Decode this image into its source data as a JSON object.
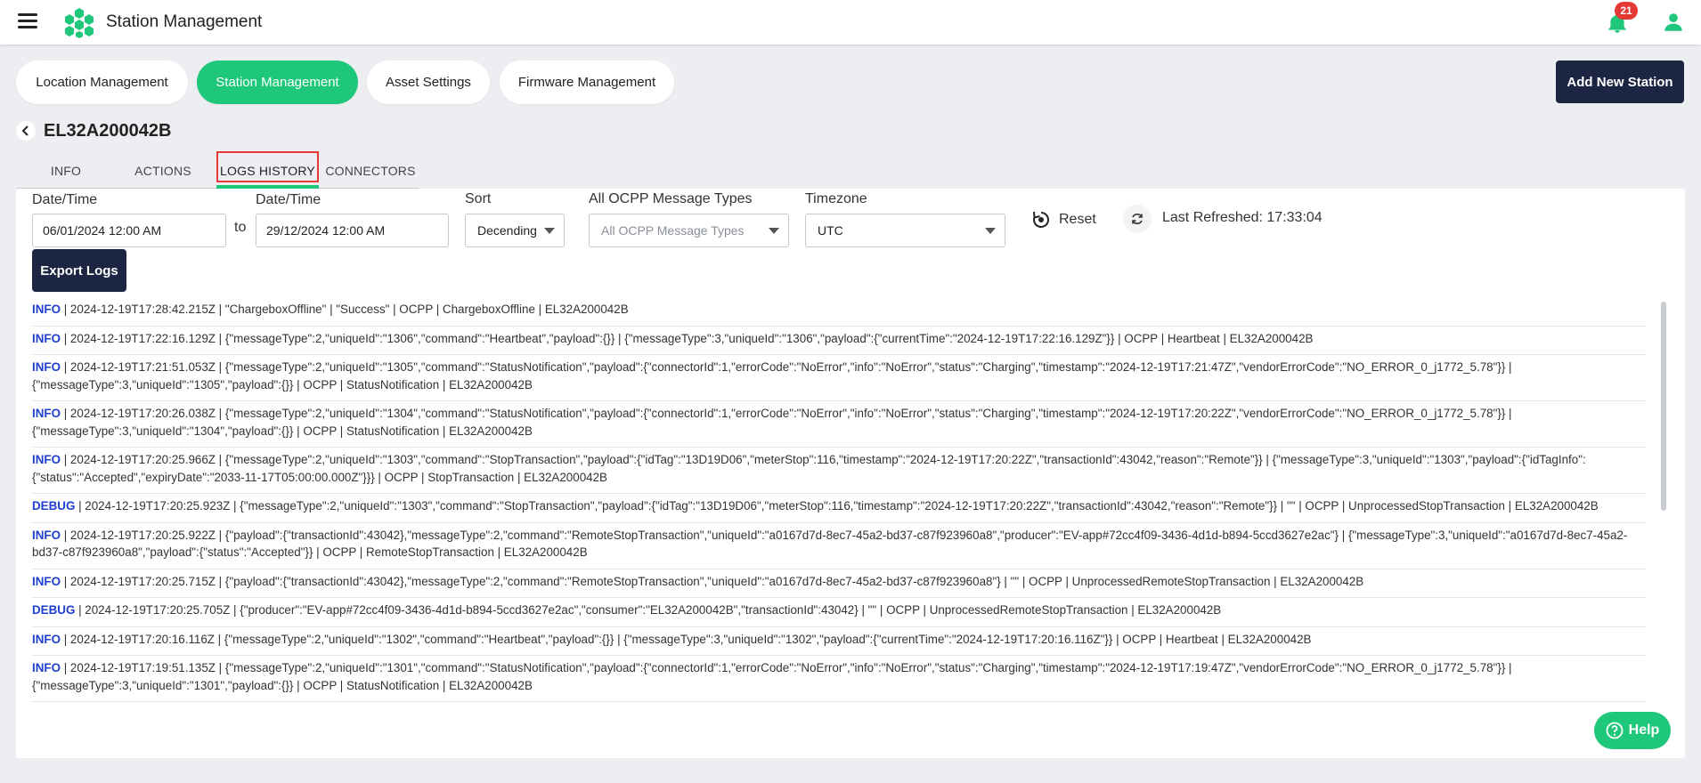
{
  "header": {
    "title": "Station Management",
    "notification_count": "21"
  },
  "main_tabs": [
    {
      "label": "Location Management",
      "active": false
    },
    {
      "label": "Station Management",
      "active": true
    },
    {
      "label": "Asset Settings",
      "active": false
    },
    {
      "label": "Firmware Management",
      "active": false
    }
  ],
  "add_station_label": "Add New Station",
  "station": {
    "id": "EL32A200042B"
  },
  "sub_tabs": [
    {
      "label": "INFO"
    },
    {
      "label": "ACTIONS"
    },
    {
      "label": "LOGS HISTORY",
      "active": true
    },
    {
      "label": "CONNECTORS"
    }
  ],
  "filters": {
    "from_label": "Date/Time",
    "from_value": "06/01/2024 12:00 AM",
    "to_text": "to",
    "to_label": "Date/Time",
    "to_value": "29/12/2024 12:00 AM",
    "sort_label": "Sort",
    "sort_value": "Decending",
    "types_label": "All OCPP Message Types",
    "types_placeholder": "All OCPP Message Types",
    "timezone_label": "Timezone",
    "timezone_value": "UTC",
    "reset_label": "Reset",
    "last_refreshed": "Last Refreshed: 17:33:04"
  },
  "export_label": "Export Logs",
  "logs": [
    {
      "level": "INFO",
      "text": " | 2024-12-19T17:28:42.215Z | \"ChargeboxOffline\" | \"Success\" | OCPP | ChargeboxOffline | EL32A200042B"
    },
    {
      "level": "INFO",
      "text": " | 2024-12-19T17:22:16.129Z | {\"messageType\":2,\"uniqueId\":\"1306\",\"command\":\"Heartbeat\",\"payload\":{}} | {\"messageType\":3,\"uniqueId\":\"1306\",\"payload\":{\"currentTime\":\"2024-12-19T17:22:16.129Z\"}} | OCPP | Heartbeat | EL32A200042B"
    },
    {
      "level": "INFO",
      "text": " | 2024-12-19T17:21:51.053Z | {\"messageType\":2,\"uniqueId\":\"1305\",\"command\":\"StatusNotification\",\"payload\":{\"connectorId\":1,\"errorCode\":\"NoError\",\"info\":\"NoError\",\"status\":\"Charging\",\"timestamp\":\"2024-12-19T17:21:47Z\",\"vendorErrorCode\":\"NO_ERROR_0_j1772_5.78\"}} | {\"messageType\":3,\"uniqueId\":\"1305\",\"payload\":{}} | OCPP | StatusNotification | EL32A200042B"
    },
    {
      "level": "INFO",
      "text": " | 2024-12-19T17:20:26.038Z | {\"messageType\":2,\"uniqueId\":\"1304\",\"command\":\"StatusNotification\",\"payload\":{\"connectorId\":1,\"errorCode\":\"NoError\",\"info\":\"NoError\",\"status\":\"Charging\",\"timestamp\":\"2024-12-19T17:20:22Z\",\"vendorErrorCode\":\"NO_ERROR_0_j1772_5.78\"}} | {\"messageType\":3,\"uniqueId\":\"1304\",\"payload\":{}} | OCPP | StatusNotification | EL32A200042B"
    },
    {
      "level": "INFO",
      "text": " | 2024-12-19T17:20:25.966Z | {\"messageType\":2,\"uniqueId\":\"1303\",\"command\":\"StopTransaction\",\"payload\":{\"idTag\":\"13D19D06\",\"meterStop\":116,\"timestamp\":\"2024-12-19T17:20:22Z\",\"transactionId\":43042,\"reason\":\"Remote\"}} | {\"messageType\":3,\"uniqueId\":\"1303\",\"payload\":{\"idTagInfo\":{\"status\":\"Accepted\",\"expiryDate\":\"2033-11-17T05:00:00.000Z\"}}} | OCPP | StopTransaction | EL32A200042B"
    },
    {
      "level": "DEBUG",
      "text": " | 2024-12-19T17:20:25.923Z | {\"messageType\":2,\"uniqueId\":\"1303\",\"command\":\"StopTransaction\",\"payload\":{\"idTag\":\"13D19D06\",\"meterStop\":116,\"timestamp\":\"2024-12-19T17:20:22Z\",\"transactionId\":43042,\"reason\":\"Remote\"}} | \"\" | OCPP | UnprocessedStopTransaction | EL32A200042B"
    },
    {
      "level": "INFO",
      "text": " | 2024-12-19T17:20:25.922Z | {\"payload\":{\"transactionId\":43042},\"messageType\":2,\"command\":\"RemoteStopTransaction\",\"uniqueId\":\"a0167d7d-8ec7-45a2-bd37-c87f923960a8\",\"producer\":\"EV-app#72cc4f09-3436-4d1d-b894-5ccd3627e2ac\"} | {\"messageType\":3,\"uniqueId\":\"a0167d7d-8ec7-45a2-bd37-c87f923960a8\",\"payload\":{\"status\":\"Accepted\"}} | OCPP | RemoteStopTransaction | EL32A200042B"
    },
    {
      "level": "INFO",
      "text": " | 2024-12-19T17:20:25.715Z | {\"payload\":{\"transactionId\":43042},\"messageType\":2,\"command\":\"RemoteStopTransaction\",\"uniqueId\":\"a0167d7d-8ec7-45a2-bd37-c87f923960a8\"} | \"\" | OCPP | UnprocessedRemoteStopTransaction | EL32A200042B"
    },
    {
      "level": "DEBUG",
      "text": " | 2024-12-19T17:20:25.705Z | {\"producer\":\"EV-app#72cc4f09-3436-4d1d-b894-5ccd3627e2ac\",\"consumer\":\"EL32A200042B\",\"transactionId\":43042} | \"\" | OCPP | UnprocessedRemoteStopTransaction | EL32A200042B"
    },
    {
      "level": "INFO",
      "text": " | 2024-12-19T17:20:16.116Z | {\"messageType\":2,\"uniqueId\":\"1302\",\"command\":\"Heartbeat\",\"payload\":{}} | {\"messageType\":3,\"uniqueId\":\"1302\",\"payload\":{\"currentTime\":\"2024-12-19T17:20:16.116Z\"}} | OCPP | Heartbeat | EL32A200042B"
    },
    {
      "level": "INFO",
      "text": " | 2024-12-19T17:19:51.135Z | {\"messageType\":2,\"uniqueId\":\"1301\",\"command\":\"StatusNotification\",\"payload\":{\"connectorId\":1,\"errorCode\":\"NoError\",\"info\":\"NoError\",\"status\":\"Charging\",\"timestamp\":\"2024-12-19T17:19:47Z\",\"vendorErrorCode\":\"NO_ERROR_0_j1772_5.78\"}} | {\"messageType\":3,\"uniqueId\":\"1301\",\"payload\":{}} | OCPP | StatusNotification | EL32A200042B"
    }
  ],
  "help_label": "Help",
  "colors": {
    "accent": "#1ec77a",
    "primary_dark": "#1c2541",
    "log_level": "#1f3fd0",
    "badge": "#e53935"
  }
}
